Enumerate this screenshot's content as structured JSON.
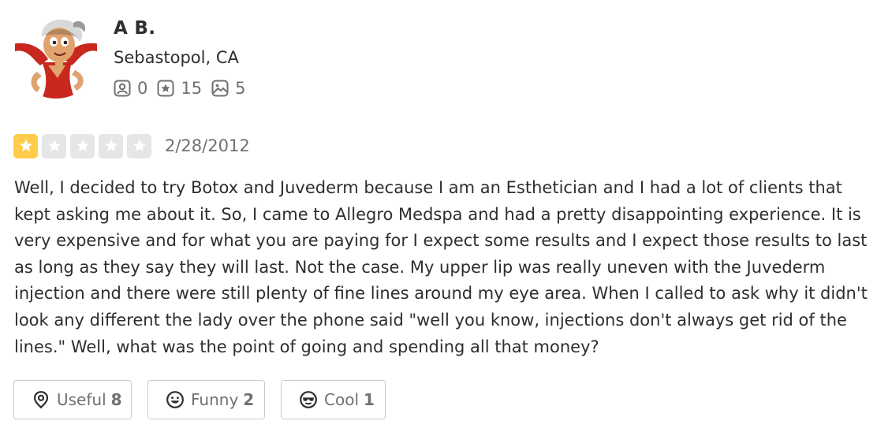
{
  "user": {
    "name": "A B.",
    "location": "Sebastopol, CA",
    "stats": {
      "friends": "0",
      "reviews": "15",
      "photos": "5"
    }
  },
  "review": {
    "rating": 1,
    "max_rating": 5,
    "date": "2/28/2012",
    "text": "Well, I decided to try Botox and Juvederm because I am an Esthetician and I had a lot of clients that kept asking me about it. So, I came to Allegro Medspa and had a pretty disappointing experience. It is very expensive and for what you are paying for I expect some results and I expect those results to last as long as they say they will last. Not the case. My upper lip was really uneven with the Juvederm injection and there were still plenty of fine lines around my eye area. When I called to ask why it didn't look any different the lady over the phone said \"well you know, injections don't always get rid of the lines.\" Well, what was the point of going and spending all that money?"
  },
  "reactions": {
    "useful": {
      "label": "Useful",
      "count": "8"
    },
    "funny": {
      "label": "Funny",
      "count": "2"
    },
    "cool": {
      "label": "Cool",
      "count": "1"
    }
  },
  "colors": {
    "star_filled": "#ffcc4b",
    "star_empty": "#e6e6e6",
    "text": "#2d2e2f",
    "muted": "#6e7072"
  },
  "icons": {
    "friends": "friends-icon",
    "reviews": "review-star-icon",
    "photos": "photo-icon",
    "useful": "lightbulb-pin-icon",
    "funny": "smile-icon",
    "cool": "sunglasses-icon"
  }
}
